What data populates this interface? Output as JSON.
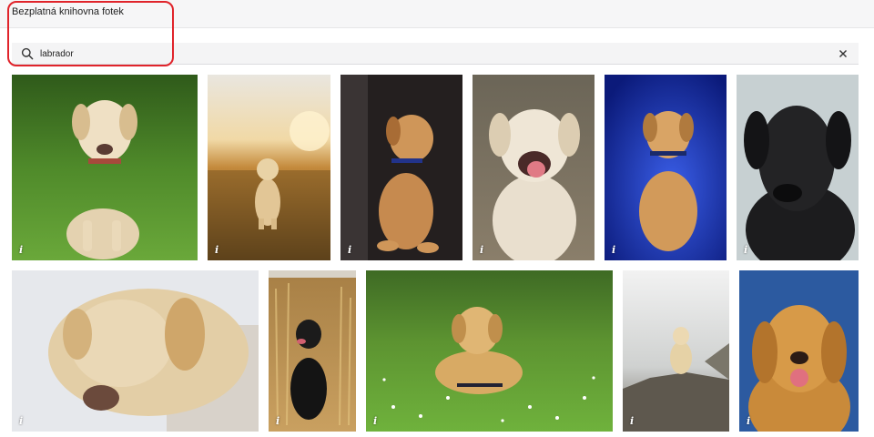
{
  "window": {
    "title": "Bezplatná knihovna fotek"
  },
  "search": {
    "value": "labrador",
    "placeholder": "",
    "icon": "search-icon",
    "clear_icon": "close-icon"
  },
  "accent": {
    "highlight_border": "#e0242b"
  },
  "photos": {
    "info_glyph": "i",
    "items": [
      {
        "subject": "yellow labrador puppy walking on grass"
      },
      {
        "subject": "labrador sitting in field at sunset"
      },
      {
        "subject": "labrador puppy with blue collar looking up, dark background"
      },
      {
        "subject": "smiling yellow labrador close-up"
      },
      {
        "subject": "labrador puppy on blue studio background"
      },
      {
        "subject": "black labrador portrait"
      },
      {
        "subject": "yellow labrador lying down"
      },
      {
        "subject": "black labrador puppy in wheat field"
      },
      {
        "subject": "golden retriever lying in meadow with daisies"
      },
      {
        "subject": "labrador sitting on rock, grey sky"
      },
      {
        "subject": "golden retriever portrait on blue background"
      }
    ]
  }
}
